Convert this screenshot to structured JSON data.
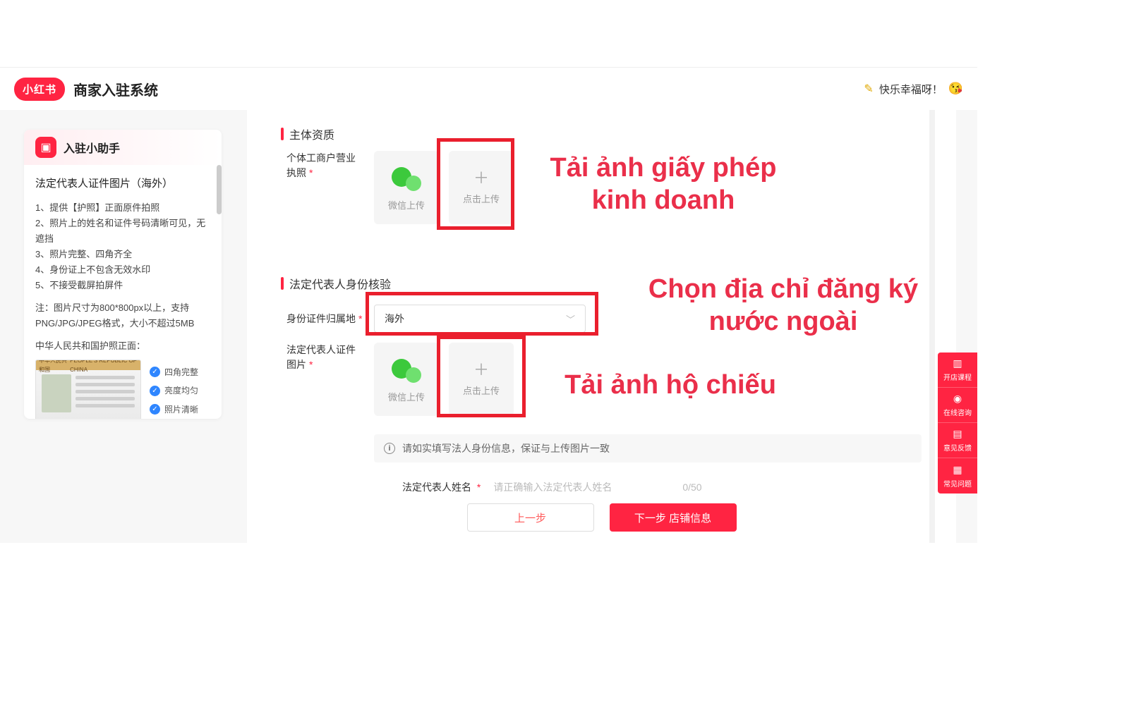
{
  "header": {
    "logo_text": "小红书",
    "title": "商家入驻系统",
    "user_greeting": "快乐幸福呀！"
  },
  "sidebar": {
    "assistant_title": "入驻小助手",
    "title2": "法定代表人证件图片（海外）",
    "tips": [
      "1、提供【护照】正面原件拍照",
      "2、照片上的姓名和证件号码清晰可见，无遮挡",
      "3、照片完整、四角齐全",
      "4、身份证上不包含无效水印",
      "5、不接受截屏拍屏件"
    ],
    "note": "注：图片尺寸为800*800px以上，支持PNG/JPG/JPEG格式，大小不超过5MB",
    "passport_caption": "中华人民共和国护照正面：",
    "checks": [
      "四角完整",
      "亮度均匀",
      "照片清晰"
    ]
  },
  "form": {
    "section1_title": "主体资质",
    "license_label": "个体工商户营业执照",
    "wechat_upload": "微信上传",
    "click_upload": "点击上传",
    "section2_title": "法定代表人身份核验",
    "belong_label": "身份证件归属地",
    "belong_value": "海外",
    "rep_photo_label": "法定代表人证件图片",
    "info_banner": "请如实填写法人身份信息，保证与上传图片一致",
    "rep_name_label": "法定代表人姓名",
    "rep_name_placeholder": "请正确输入法定代表人姓名",
    "rep_name_count": "0/50",
    "prev_btn": "上一步",
    "next_btn": "下一步 店铺信息"
  },
  "annotations": {
    "a1_line1": "Tải ảnh giấy phép",
    "a1_line2": "kinh doanh",
    "a2_line1": "Chọn địa chỉ đăng ký",
    "a2_line2": "nước ngoài",
    "a3": "Tải ảnh hộ chiếu"
  },
  "side_panel": {
    "items": [
      "开店课程",
      "在线咨询",
      "意见反馈",
      "常见问题"
    ]
  }
}
